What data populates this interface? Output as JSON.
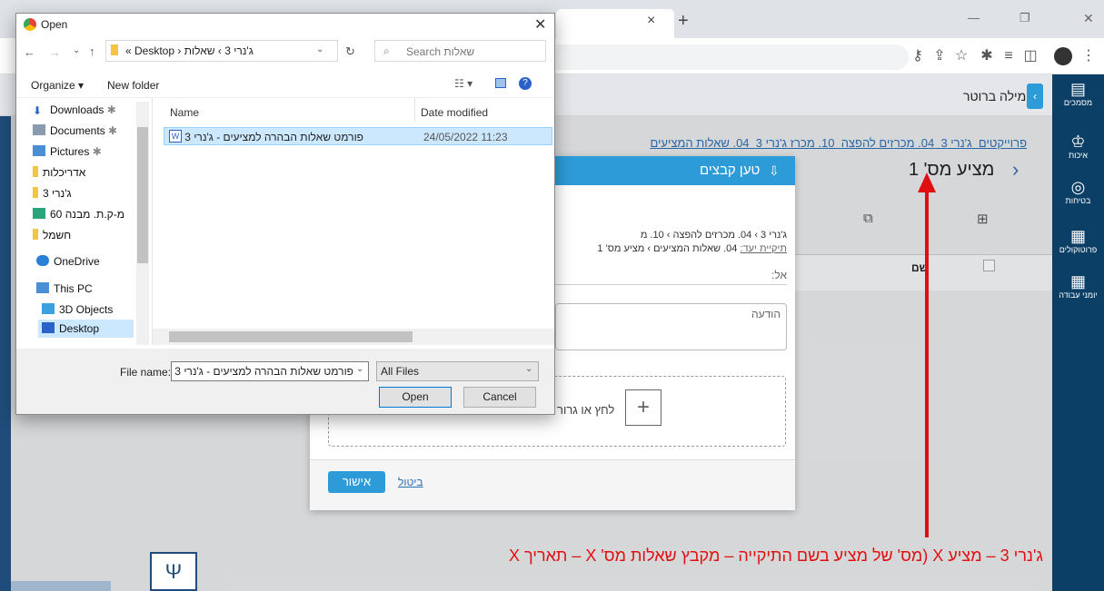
{
  "chrome": {
    "tab_close": "×",
    "tab_new": "+"
  },
  "sidebar_nav": [
    {
      "label": "מסמכים",
      "icon": "documents-icon",
      "glyph": "▤"
    },
    {
      "label": "איכות",
      "icon": "quality-icon",
      "glyph": "♔"
    },
    {
      "label": "בטיחות",
      "icon": "safety-icon",
      "glyph": "◎"
    },
    {
      "label": "פרוטוקולים",
      "icon": "protocols-icon",
      "glyph": "▦"
    },
    {
      "label": "יומני עבודה",
      "icon": "calendar-icon",
      "glyph": "▦"
    }
  ],
  "app": {
    "project": "מילה ברוטר",
    "breadcrumb": [
      "פרוייקטים",
      "ג'נרי 3",
      "04. מכרזים להפצה",
      "10. מכרז ג'נרי 3",
      "04. שאלות המציעים"
    ],
    "page_title": "מציע מס' 1",
    "column_name": "שם"
  },
  "upload_modal": {
    "title": "טען קבצים",
    "path_line1": "ג'נרי 3 › 04. מכרזים להפצה › 10. מ",
    "path_label": "תיקיית יעד:",
    "path_line2": "04. שאלות המציעים › מציע מס' 1",
    "to_label": "אל:",
    "message_placeholder": "הודעה",
    "drop_text": "לחץ או גרור",
    "confirm": "אישור",
    "cancel": "ביטול"
  },
  "file_dialog": {
    "title": "Open",
    "path": [
      "« Desktop",
      "ג'נרי 3",
      "שאלות"
    ],
    "search_placeholder": "Search שאלות",
    "organize": "Organize ▾",
    "new_folder": "New folder",
    "nav_items": [
      {
        "label": "Downloads",
        "color": "#2a62c9"
      },
      {
        "label": "Documents",
        "color": "#8a9bb0"
      },
      {
        "label": "Pictures",
        "color": "#4a8fd6"
      },
      {
        "label": "אדריכלות",
        "color": "#f2c542"
      },
      {
        "label": "ג'נרי 3",
        "color": "#f2c542"
      },
      {
        "label": "מ-ק.ת. מבנה 60",
        "color": "#2aa57a"
      },
      {
        "label": "חשמל",
        "color": "#f2c542"
      },
      {
        "label": "OneDrive",
        "color": "#2a7fd6"
      },
      {
        "label": "This PC",
        "color": "#4a8fd6"
      },
      {
        "label": "3D Objects",
        "color": "#3aa0e0"
      },
      {
        "label": "Desktop",
        "color": "#2a62c9"
      }
    ],
    "col_name": "Name",
    "col_date": "Date modified",
    "file_name": "פורמט שאלות הבהרה למציעים - ג'נרי 3",
    "file_date": "24/05/2022 11:23",
    "filename_label": "File name:",
    "filename_value": "פורמט שאלות הבהרה למציעים - ג'נרי 3",
    "filter": "All Files",
    "open": "Open",
    "cancel": "Cancel"
  },
  "annotation": "ג'נרי 3 – מציע X (מס' של מציע בשם התיקייה – מקבץ שאלות מס' X – תאריך X"
}
